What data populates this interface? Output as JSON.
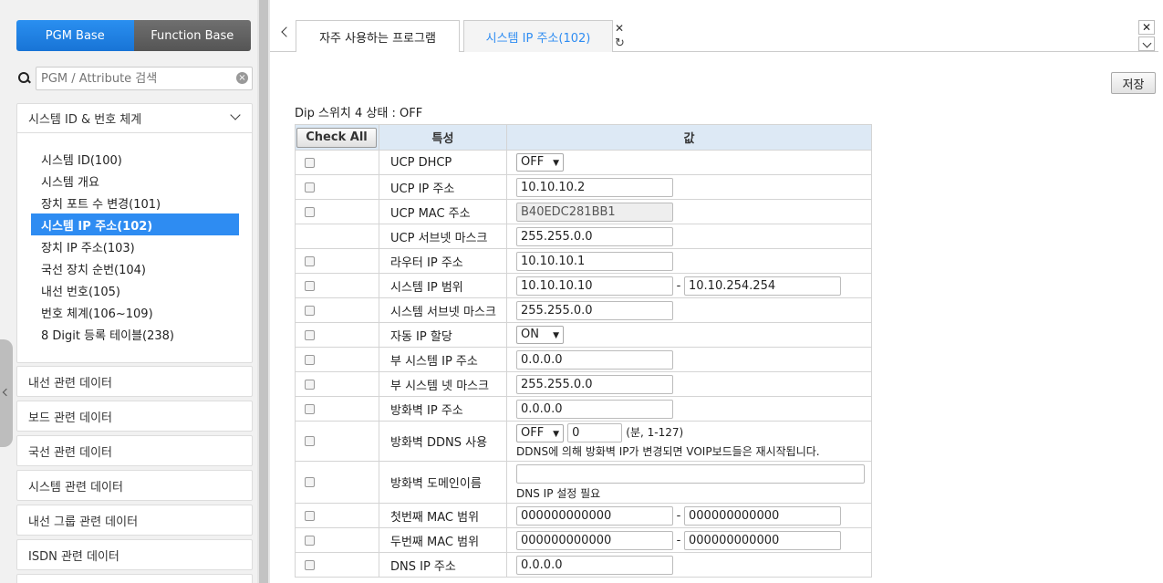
{
  "sidebar": {
    "pgm_base": "PGM Base",
    "function_base": "Function Base",
    "search_placeholder": "PGM / Attribute 검색",
    "open_group": {
      "label": "시스템 ID & 번호 체계",
      "items": [
        {
          "label": "시스템 ID(100)"
        },
        {
          "label": "시스템 개요"
        },
        {
          "label": "장치 포트 수 변경(101)"
        },
        {
          "label": "시스템 IP 주소(102)"
        },
        {
          "label": "장치 IP 주소(103)"
        },
        {
          "label": "국선 장치 순번(104)"
        },
        {
          "label": "내선 번호(105)"
        },
        {
          "label": "번호 체계(106~109)"
        },
        {
          "label": "8 Digit 등록 테이블(238)"
        }
      ]
    },
    "groups": [
      "내선 관련 데이터",
      "보드 관련 데이터",
      "국선 관련 데이터",
      "시스템 관련 데이터",
      "내선 그룹 관련 데이터",
      "ISDN 관련 데이터"
    ]
  },
  "tabs": {
    "t1": "자주 사용하는 프로그램",
    "t2": "시스템 IP 주소(102)"
  },
  "save_label": "저장",
  "dip_status": "Dip 스위치 4 상태 : OFF",
  "table": {
    "check_all": "Check All",
    "col_prop": "특성",
    "col_val": "값",
    "rows": {
      "r0": {
        "prop": "UCP DHCP",
        "sel": "OFF"
      },
      "r1": {
        "prop": "UCP IP 주소",
        "v1": "10.10.10.2"
      },
      "r2": {
        "prop": "UCP MAC 주소",
        "v1": "B40EDC281BB1"
      },
      "r3": {
        "prop": "UCP 서브넷 마스크",
        "v1": "255.255.0.0"
      },
      "r4": {
        "prop": "라우터 IP 주소",
        "v1": "10.10.10.1"
      },
      "r5": {
        "prop": "시스템 IP 범위",
        "v1": "10.10.10.10",
        "v2": "10.10.254.254"
      },
      "r6": {
        "prop": "시스템 서브넷 마스크",
        "v1": "255.255.0.0"
      },
      "r7": {
        "prop": "자동 IP 할당",
        "sel": "ON"
      },
      "r8": {
        "prop": "부 시스템 IP 주소",
        "v1": "0.0.0.0"
      },
      "r9": {
        "prop": "부 시스템 넷 마스크",
        "v1": "255.255.0.0"
      },
      "r10": {
        "prop": "방화벽 IP 주소",
        "v1": "0.0.0.0"
      },
      "r11": {
        "prop": "방화벽 DDNS 사용",
        "sel": "OFF",
        "v1": "0",
        "range": "(분, 1-127)",
        "note": "DDNS에 의해 방화벽 IP가 변경되면 VOIP보드들은 재시작됩니다."
      },
      "r12": {
        "prop": "방화벽 도메인이름",
        "v1": "",
        "note": "DNS IP 설정 필요"
      },
      "r13": {
        "prop": "첫번째 MAC 범위",
        "v1": "000000000000",
        "v2": "000000000000"
      },
      "r14": {
        "prop": "두번째 MAC 범위",
        "v1": "000000000000",
        "v2": "000000000000"
      },
      "r15": {
        "prop": "DNS IP 주소",
        "v1": "0.0.0.0"
      }
    }
  }
}
